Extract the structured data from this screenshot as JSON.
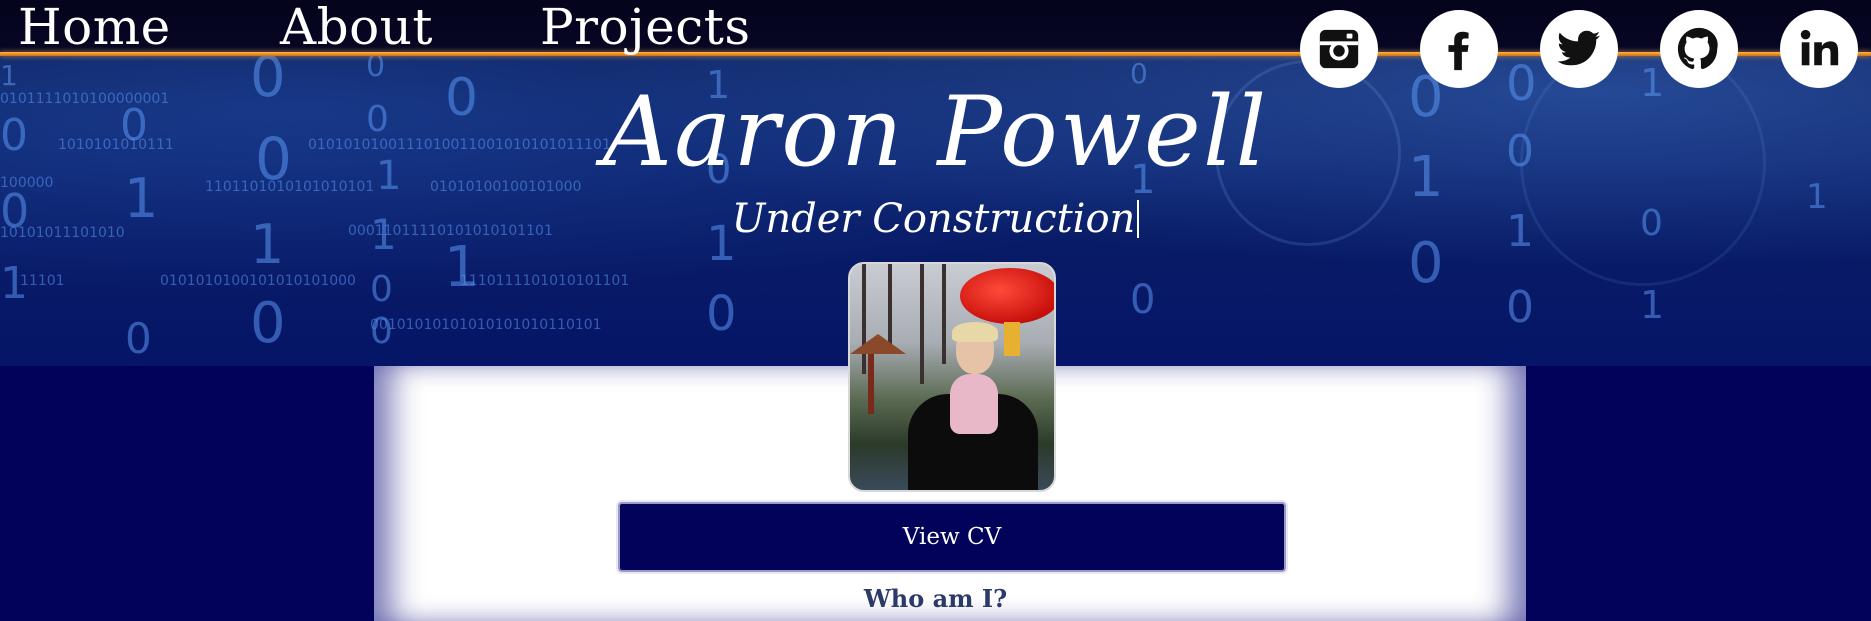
{
  "nav": {
    "home": "Home",
    "about": "About",
    "projects": "Projects"
  },
  "social": [
    {
      "icon": "instagram-icon"
    },
    {
      "icon": "facebook-icon"
    },
    {
      "icon": "twitter-icon"
    },
    {
      "icon": "github-icon"
    },
    {
      "icon": "linkedin-icon"
    }
  ],
  "hero": {
    "name": "Aaron Powell",
    "tagline": "Under Construction"
  },
  "content": {
    "cv_button": "View CV",
    "section_heading": "Who am I?"
  },
  "colors": {
    "navy": "#02025a",
    "accent_line": "#e08a20",
    "white": "#ffffff",
    "heading": "#2c3a6a"
  }
}
